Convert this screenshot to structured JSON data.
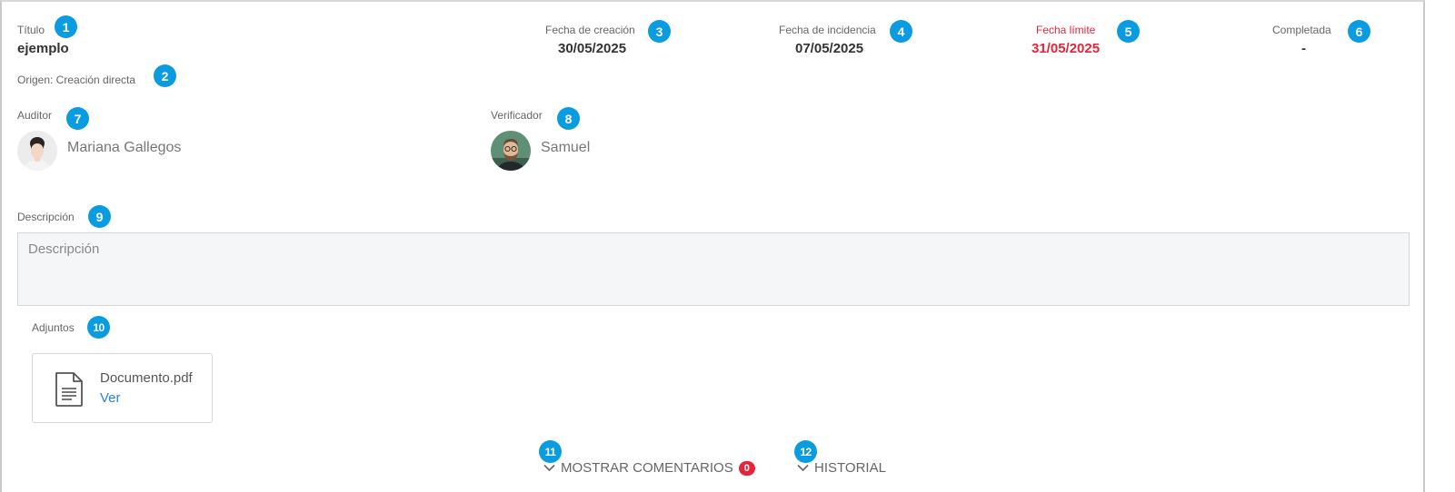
{
  "fields": {
    "title_label": "Título",
    "title_value": "ejemplo",
    "origin_text": "Origen: Creación directa",
    "created_label": "Fecha de creación",
    "created_value": "30/05/2025",
    "incident_label": "Fecha de incidencia",
    "incident_value": "07/05/2025",
    "due_label": "Fecha límite",
    "due_value": "31/05/2025",
    "completed_label": "Completada",
    "completed_value": "-"
  },
  "people": {
    "auditor_label": "Auditor",
    "auditor_name": "Mariana Gallegos",
    "verifier_label": "Verificador",
    "verifier_name": "Samuel"
  },
  "description": {
    "label": "Descripción",
    "placeholder": "Descripción",
    "value": ""
  },
  "attachments": {
    "label": "Adjuntos",
    "items": [
      {
        "file_name": "Documento.pdf",
        "action": "Ver"
      }
    ]
  },
  "footer": {
    "comments_label": "MOSTRAR COMENTARIOS",
    "comments_count": "0",
    "history_label": "HISTORIAL"
  },
  "callouts": [
    "1",
    "2",
    "3",
    "4",
    "5",
    "6",
    "7",
    "8",
    "9",
    "10",
    "11",
    "12"
  ],
  "colors": {
    "callout": "#0b9be0",
    "due_date": "#e5253a",
    "link": "#2b85d6",
    "count_badge": "#e5253a"
  }
}
